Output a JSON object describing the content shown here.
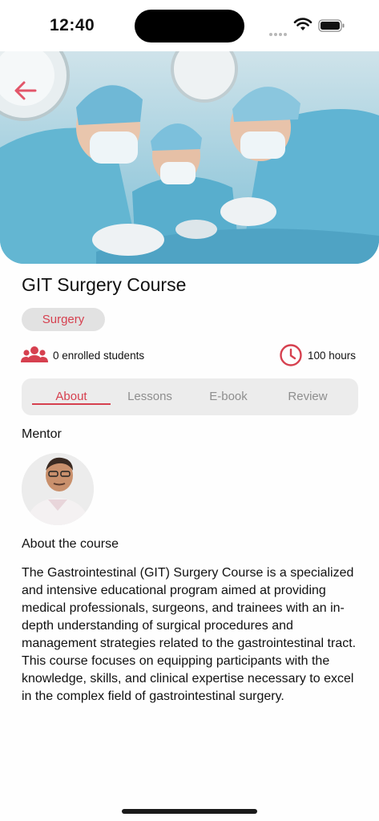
{
  "status_bar": {
    "time": "12:40"
  },
  "hero": {
    "image_description": "surgery-photo"
  },
  "course": {
    "title": "GIT Surgery Course",
    "category": "Surgery",
    "enrolled": "0 enrolled students",
    "duration": "100 hours"
  },
  "tabs": [
    {
      "label": "About",
      "active": true
    },
    {
      "label": "Lessons",
      "active": false
    },
    {
      "label": "E-book",
      "active": false
    },
    {
      "label": "Review",
      "active": false
    }
  ],
  "mentor": {
    "heading": "Mentor"
  },
  "about": {
    "heading": "About the course",
    "text": "The Gastrointestinal (GIT) Surgery Course is a specialized and intensive educational program aimed at providing medical professionals, surgeons, and trainees with an in-depth understanding of surgical procedures and management strategies related to the gastrointestinal tract. This course focuses on equipping participants with the knowledge, skills, and clinical expertise necessary to excel in the complex field of gastrointestinal surgery."
  },
  "colors": {
    "accent": "#d6404f",
    "chip_bg": "#e2e2e2",
    "tabs_bg": "#ececec"
  },
  "icons": {
    "back": "arrow-left-icon",
    "students": "users-icon",
    "duration": "clock-icon"
  }
}
